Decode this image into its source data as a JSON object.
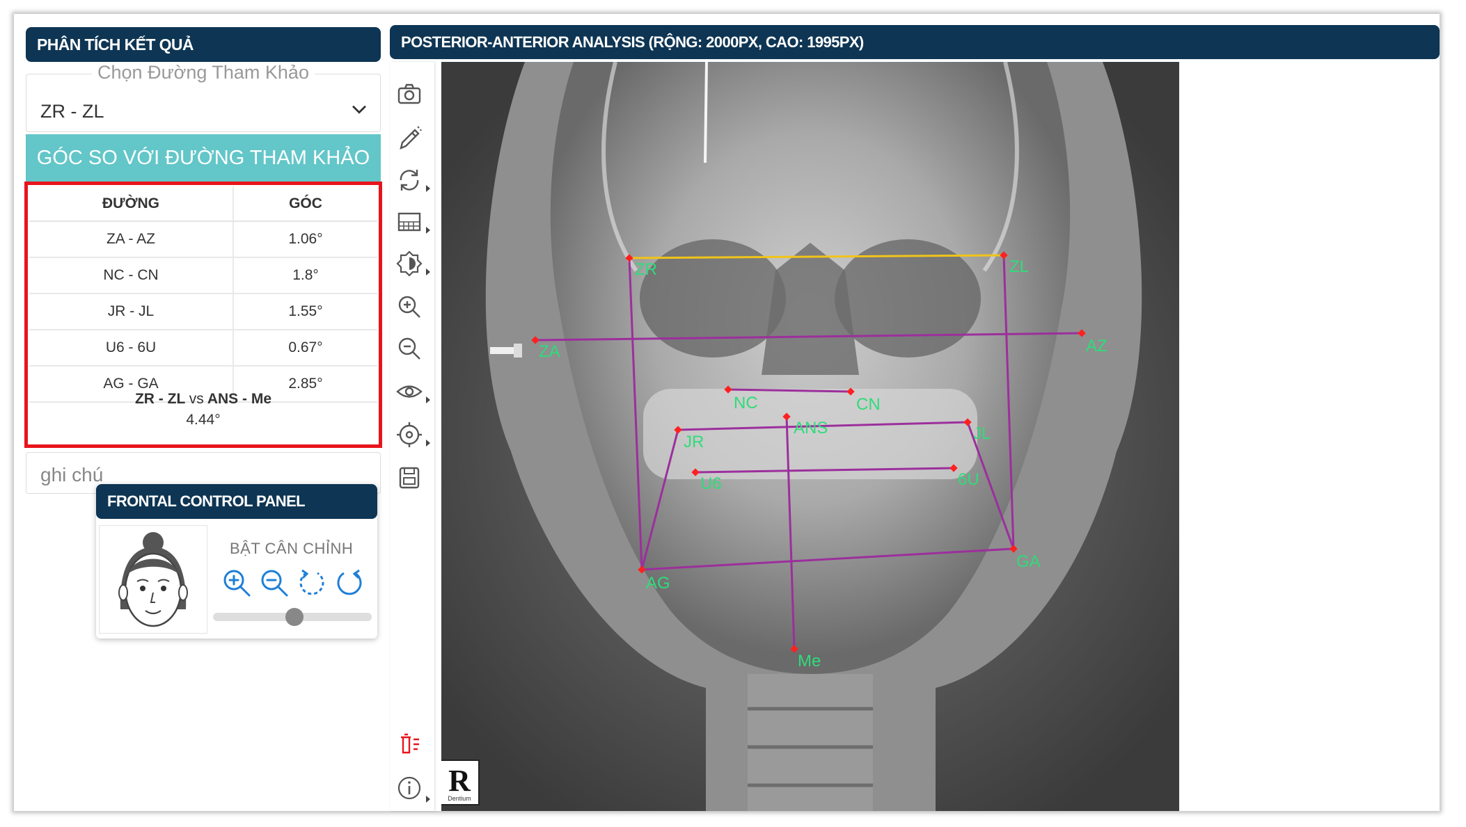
{
  "analysis_panel": {
    "title": "PHÂN TÍCH KẾT QUẢ",
    "reference_legend": "Chọn Đường Tham Khảo",
    "reference_value": "ZR - ZL",
    "angle_header": "GÓC SO VỚI ĐƯỜNG THAM KHẢO",
    "table": {
      "headers": [
        "ĐƯỜNG",
        "GÓC"
      ],
      "rows": [
        {
          "line": "ZA - AZ",
          "angle": "1.06°"
        },
        {
          "line": "NC - CN",
          "angle": "1.8°"
        },
        {
          "line": "JR - JL",
          "angle": "1.55°"
        },
        {
          "line": "U6 - 6U",
          "angle": "0.67°"
        },
        {
          "line": "AG - GA",
          "angle": "2.85°"
        }
      ]
    },
    "footer": {
      "ref": "ZR - ZL",
      "vs": "vs",
      "target": "ANS - Me",
      "value": "4.44°"
    },
    "note_placeholder": "ghi chú"
  },
  "control_panel": {
    "title": "FRONTAL CONTROL PANEL",
    "toggle_label": "BẬT CÂN CHỈNH",
    "icons": [
      "zoom-in-icon",
      "zoom-out-icon",
      "rotate-left-icon",
      "rotate-right-icon"
    ],
    "slider_fraction": 0.5
  },
  "toolbar": {
    "icons": [
      "camera-icon",
      "pencil-icon",
      "rotate-icon",
      "grid-icon",
      "brightness-icon",
      "zoom-in-icon",
      "zoom-out-icon",
      "eye-icon",
      "target-icon",
      "save-icon",
      "delete-list-icon",
      "info-icon"
    ]
  },
  "xray": {
    "title": "POSTERIOR-ANTERIOR ANALYSIS (RỘNG: 2000PX, CAO: 1995PX)",
    "brand_letter": "R",
    "brand_sub": "Dentium",
    "landmarks": [
      "ZR",
      "ZL",
      "ZA",
      "AZ",
      "NC",
      "CN",
      "ANS",
      "JR",
      "JL",
      "U6",
      "6U",
      "AG",
      "GA",
      "Me"
    ],
    "colors": {
      "reference_line": "#f0c419",
      "analysis_line": "#9c2f9c",
      "landmark": "#ff2020",
      "label": "#2fdc7a"
    }
  },
  "theme": {
    "header_bg": "#0e3553",
    "accent": "#63c6c8",
    "highlight": "#e8141c"
  }
}
